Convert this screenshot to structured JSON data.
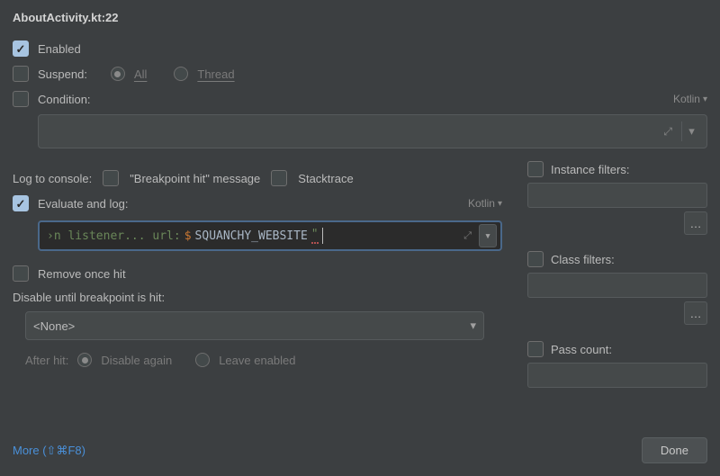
{
  "title": "AboutActivity.kt:22",
  "kotlinChip": "Kotlin",
  "options": {
    "enabled": {
      "label": "Enabled",
      "checked": true
    },
    "suspend": {
      "label": "Suspend:",
      "checked": false,
      "all": "All",
      "thread": "Thread",
      "selected": "all"
    },
    "condition": {
      "label": "Condition:",
      "checked": false
    }
  },
  "logToConsole": {
    "label": "Log to console:",
    "bpHit": {
      "label": "\"Breakpoint hit\" message",
      "checked": false
    },
    "stacktrace": {
      "label": "Stacktrace",
      "checked": false
    }
  },
  "evaluate": {
    "label": "Evaluate and log:",
    "checked": true,
    "code": {
      "prefix": "›n listener... url: ",
      "dollar": "$",
      "var": "SQUANCHY_WEBSITE",
      "quote": "\""
    }
  },
  "removeOnceHit": {
    "label": "Remove once hit",
    "checked": false
  },
  "disableUntil": {
    "label": "Disable until breakpoint is hit:",
    "value": "<None>"
  },
  "afterHit": {
    "label": "After hit:",
    "disableAgain": "Disable again",
    "leaveEnabled": "Leave enabled",
    "selected": "disableAgain"
  },
  "filters": {
    "instance": {
      "label": "Instance filters:",
      "checked": false
    },
    "class": {
      "label": "Class filters:",
      "checked": false
    },
    "passCount": {
      "label": "Pass count:",
      "checked": false
    }
  },
  "moreLink": "More (⇧⌘F8)",
  "doneButton": "Done",
  "ellipsis": "…"
}
